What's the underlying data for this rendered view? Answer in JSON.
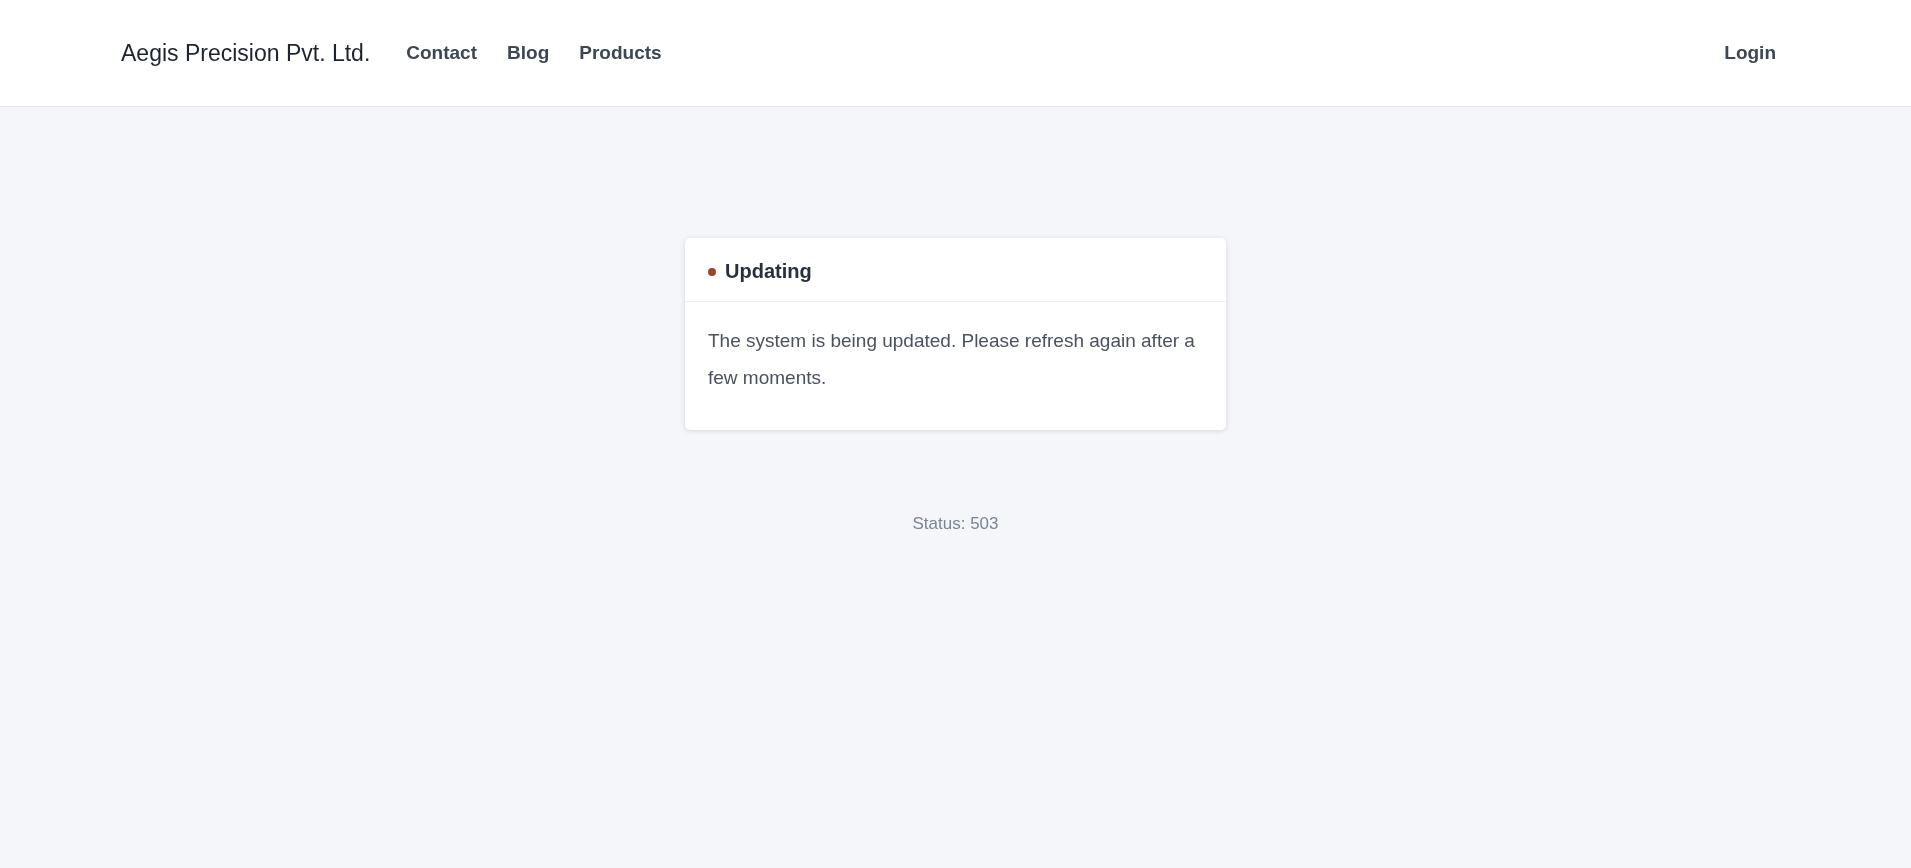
{
  "header": {
    "brand": "Aegis Precision Pvt. Ltd.",
    "nav": [
      "Contact",
      "Blog",
      "Products"
    ],
    "login": "Login"
  },
  "notice": {
    "title": "Updating",
    "message": "The system is being updated. Please refresh again after a few moments."
  },
  "status": "Status: 503"
}
